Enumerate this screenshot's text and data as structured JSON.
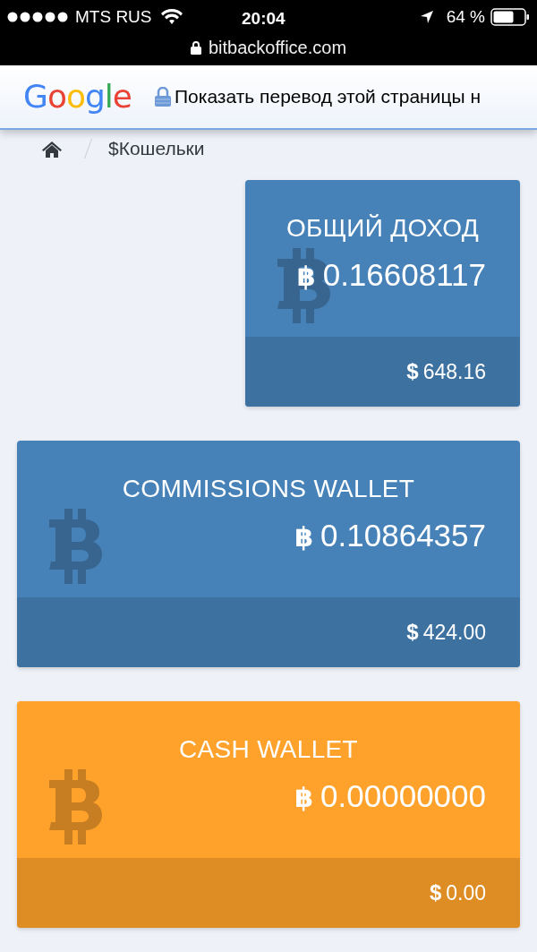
{
  "status_bar": {
    "carrier": "MTS RUS",
    "time": "20:04",
    "battery": "64 %",
    "url": "bitbackoffice.com"
  },
  "translate_bar": {
    "logo": "Google",
    "message": "Показать перевод этой страницы н"
  },
  "breadcrumb": {
    "current": "$Кошельки"
  },
  "cards": [
    {
      "kind": "summary",
      "title": "ОБЩИЙ ДОХОД",
      "color": "#4682b8",
      "currency_icon": "฿",
      "amount": "0.16608117",
      "usd_icon": "$",
      "usd": "648.16"
    },
    {
      "kind": "wallet",
      "title": "COMMISSIONS WALLET",
      "color": "#4682b8",
      "currency_icon": "฿",
      "amount": "0.10864357",
      "usd_icon": "$",
      "usd": "424.00"
    },
    {
      "kind": "wallet",
      "title": "CASH WALLET",
      "color": "#ffa22b",
      "currency_icon": "฿",
      "amount": "0.00000000",
      "usd_icon": "$",
      "usd": "0.00"
    }
  ]
}
